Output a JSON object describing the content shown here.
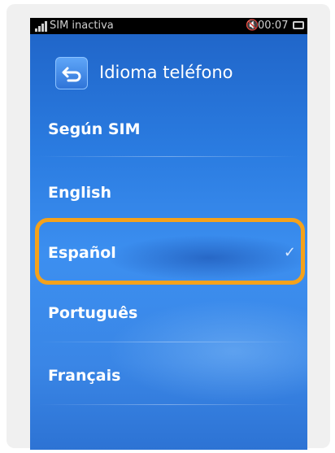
{
  "status_bar": {
    "sim_status": "SIM inactiva",
    "time": "00:07"
  },
  "header": {
    "title": "Idioma teléfono",
    "back_icon": "back-arrow-icon"
  },
  "languages": [
    {
      "label": "Según SIM",
      "selected": false
    },
    {
      "label": "English",
      "selected": false
    },
    {
      "label": "Español",
      "selected": true
    },
    {
      "label": "Português",
      "selected": false
    },
    {
      "label": "Français",
      "selected": false
    }
  ],
  "colors": {
    "highlight": "#f5a21b",
    "background": "#2a7be0"
  }
}
